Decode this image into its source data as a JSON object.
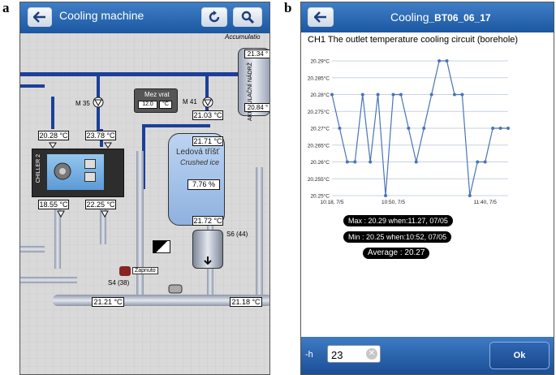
{
  "panel_labels": {
    "a": "a",
    "b": "b"
  },
  "panel_a": {
    "title": "Cooling machine",
    "icons": {
      "back": "back-arrow-icon",
      "refresh": "refresh-icon",
      "search": "search-icon"
    },
    "labels": {
      "accumulation": "Accumulatio",
      "tank_right_top": "21.34 °",
      "tank_right_text": "AKUMULAČNÍ NÁDRŽ",
      "tank_right_bottom": "20.84 °",
      "mez_vrat": "Mez vrat",
      "setpoint": "12.0",
      "setpoint_unit": "°C",
      "m35": "M 35",
      "m41": "M 41",
      "t_2103": "21.03 °C",
      "t_2171": "21.71 °C",
      "ice_title": "Ledová tříšť",
      "ice_sub": "Crushed ice",
      "ice_pct": "7.76 %",
      "t_2172": "21.72 °C",
      "t_2028": "20.28 °C",
      "t_2378": "23.78 °C",
      "chiller": "CHILLER 2",
      "t_1855": "18.55 °C",
      "t_2225": "22.25 °C",
      "s6": "S6 (44)",
      "s4": "S4 (38)",
      "zapnuto": "Zapnuto",
      "t_2121": "21.21 °C",
      "t_2118": "21.18 °C"
    }
  },
  "panel_b": {
    "title_prefix": "Cooling",
    "title_suffix": "_BT06_06_17",
    "chart_title": "CH1 The outlet temperature cooling circuit (borehole)",
    "stats": {
      "max": "Max : 20.29 when:11.27, 07/05",
      "min": "Min : 20.25 when:10:52, 07/05",
      "average": "Average : 20.27"
    },
    "footer": {
      "label": "-h",
      "input_value": "23",
      "ok": "Ok"
    },
    "colors": {
      "line": "#4a74b8",
      "header": "#2e68b5"
    }
  },
  "chart_data": {
    "type": "line",
    "title": "CH1 The outlet temperature cooling circuit (borehole)",
    "ylim": [
      20.25,
      20.29
    ],
    "yticks": [
      "20.29°C",
      "20.285°C",
      "20.28°C",
      "20.275°C",
      "20.27°C",
      "20.265°C",
      "20.26°C",
      "20.255°C",
      "20.25°C"
    ],
    "yvals": [
      20.29,
      20.285,
      20.28,
      20.275,
      20.27,
      20.265,
      20.26,
      20.255,
      20.25
    ],
    "xticks": [
      "10:18, 7/5",
      "10:50, 7/5",
      "11:40, 7/5"
    ],
    "xtick_index": [
      0,
      8,
      20
    ],
    "grid": true,
    "series": [
      {
        "values": [
          20.28,
          20.27,
          20.26,
          20.26,
          20.28,
          20.26,
          20.28,
          20.25,
          20.28,
          20.28,
          20.27,
          20.26,
          20.27,
          20.28,
          20.29,
          20.29,
          20.28,
          20.28,
          20.25,
          20.26,
          20.26,
          20.27,
          20.27,
          20.27
        ]
      }
    ]
  }
}
